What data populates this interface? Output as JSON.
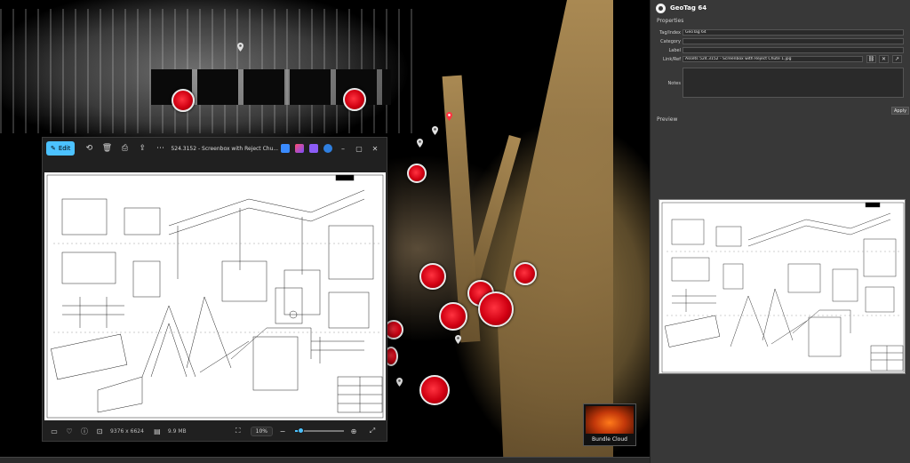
{
  "viewer": {
    "edit_label": "Edit",
    "title": "524.3152 - Screenbox with Reject Chu...",
    "status": {
      "dimensions": "9376 x 6624",
      "filesize": "9.9 MB",
      "zoom": "10%",
      "zoom_fraction": 0.1
    }
  },
  "bundle": {
    "label": "Bundle Cloud"
  },
  "panel": {
    "title": "GeoTag 64",
    "properties_label": "Properties",
    "fields": {
      "tag_index": {
        "label": "Tag/Index",
        "value": "GeoTag 64"
      },
      "category": {
        "label": "Category",
        "value": ""
      },
      "label": {
        "label": "Label",
        "value": ""
      },
      "link_ref": {
        "label": "Link/Ref",
        "value": "Assets 524.3152 - Screenbox with Reject Chute 1.jpg"
      },
      "notes": {
        "label": "Notes",
        "value": ""
      }
    },
    "apply_label": "Apply",
    "preview_label": "Preview"
  },
  "colors": {
    "accent": "#4cc2ff",
    "marker": "#d10012",
    "panel_bg": "#383838"
  }
}
